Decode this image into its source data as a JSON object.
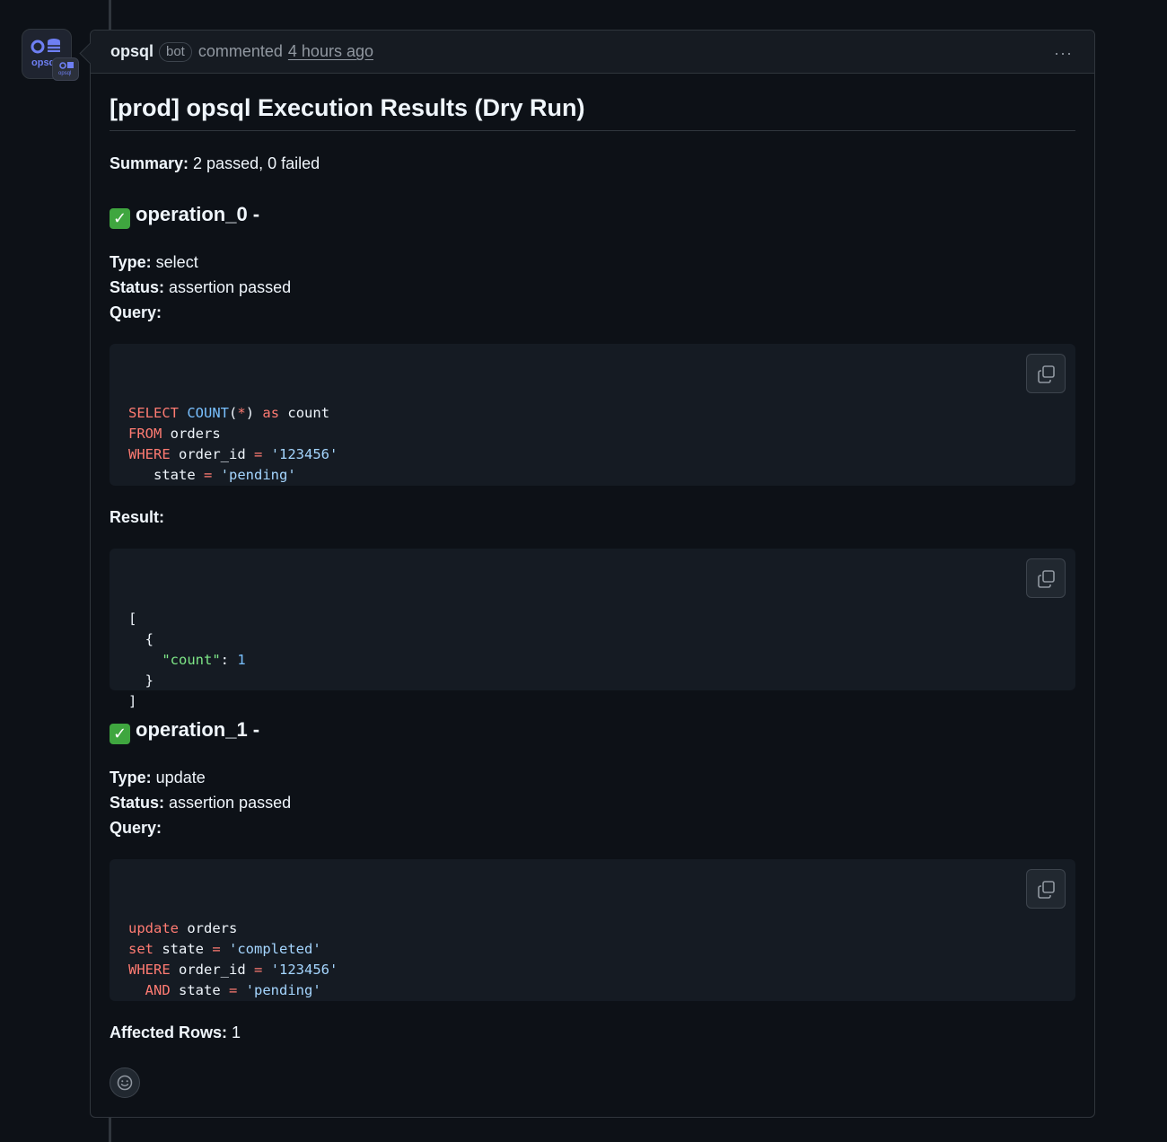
{
  "avatar": {
    "label": "opsql",
    "badge_label": "opsql"
  },
  "header": {
    "author": "opsql",
    "badge": "bot",
    "action": "commented",
    "time": "4 hours ago",
    "menu": "···"
  },
  "comment": {
    "title": "[prod] opsql Execution Results (Dry Run)",
    "summary_label": "Summary:",
    "summary_value": " 2 passed, 0 failed",
    "operations": [
      {
        "title": "operation_0 -",
        "type_label": "Type:",
        "type_value": " select",
        "status_label": "Status:",
        "status_value": " assertion passed",
        "query_label": "Query:",
        "query_lines": [
          [
            {
              "t": "SELECT",
              "c": "kw"
            },
            {
              "t": " ",
              "c": ""
            },
            {
              "t": "COUNT",
              "c": "fn"
            },
            {
              "t": "(",
              "c": ""
            },
            {
              "t": "*",
              "c": "kw"
            },
            {
              "t": ") ",
              "c": ""
            },
            {
              "t": "as",
              "c": "kw"
            },
            {
              "t": " count",
              "c": ""
            }
          ],
          [
            {
              "t": "FROM",
              "c": "kw"
            },
            {
              "t": " orders",
              "c": ""
            }
          ],
          [
            {
              "t": "WHERE",
              "c": "kw"
            },
            {
              "t": " order_id ",
              "c": ""
            },
            {
              "t": "=",
              "c": "kw"
            },
            {
              "t": " ",
              "c": ""
            },
            {
              "t": "'123456'",
              "c": "str"
            }
          ],
          [
            {
              "t": "   state ",
              "c": ""
            },
            {
              "t": "=",
              "c": "kw"
            },
            {
              "t": " ",
              "c": ""
            },
            {
              "t": "'pending'",
              "c": "str"
            }
          ]
        ],
        "result_label": "Result:",
        "result_lines": [
          [
            {
              "t": "[",
              "c": ""
            }
          ],
          [
            {
              "t": "  {",
              "c": ""
            }
          ],
          [
            {
              "t": "    ",
              "c": ""
            },
            {
              "t": "\"count\"",
              "c": "jkey"
            },
            {
              "t": ": ",
              "c": ""
            },
            {
              "t": "1",
              "c": "num"
            }
          ],
          [
            {
              "t": "  }",
              "c": ""
            }
          ],
          [
            {
              "t": "]",
              "c": ""
            }
          ]
        ]
      },
      {
        "title": "operation_1 -",
        "type_label": "Type:",
        "type_value": " update",
        "status_label": "Status:",
        "status_value": " assertion passed",
        "query_label": "Query:",
        "query_lines": [
          [
            {
              "t": "update",
              "c": "kw"
            },
            {
              "t": " orders",
              "c": ""
            }
          ],
          [
            {
              "t": "set",
              "c": "kw"
            },
            {
              "t": " state ",
              "c": ""
            },
            {
              "t": "=",
              "c": "kw"
            },
            {
              "t": " ",
              "c": ""
            },
            {
              "t": "'completed'",
              "c": "str"
            }
          ],
          [
            {
              "t": "WHERE",
              "c": "kw"
            },
            {
              "t": " order_id ",
              "c": ""
            },
            {
              "t": "=",
              "c": "kw"
            },
            {
              "t": " ",
              "c": ""
            },
            {
              "t": "'123456'",
              "c": "str"
            }
          ],
          [
            {
              "t": "  ",
              "c": ""
            },
            {
              "t": "AND",
              "c": "kw"
            },
            {
              "t": " state ",
              "c": ""
            },
            {
              "t": "=",
              "c": "kw"
            },
            {
              "t": " ",
              "c": ""
            },
            {
              "t": "'pending'",
              "c": "str"
            }
          ]
        ],
        "affected_label": "Affected Rows:",
        "affected_value": " 1"
      }
    ]
  },
  "colors": {
    "background": "#0d1117",
    "keyword": "#ff7b72",
    "function": "#79c0ff",
    "string": "#a5d6ff",
    "json_key": "#7ee787",
    "check": "#3fa63f"
  },
  "icons": {
    "copy": "copy-icon",
    "check": "check-mark-icon",
    "emoji": "smiley-icon",
    "menu": "kebab-icon"
  }
}
